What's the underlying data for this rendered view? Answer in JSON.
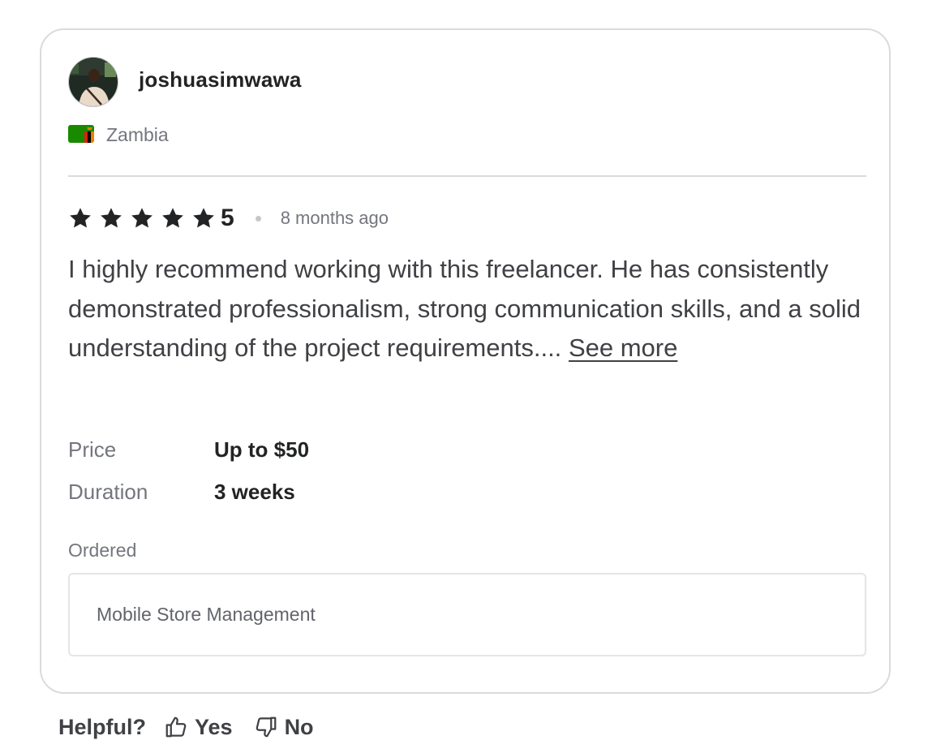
{
  "review": {
    "username": "joshuasimwawa",
    "country": "Zambia",
    "flag_icon": "zambia-flag-icon",
    "rating": {
      "stars": 5,
      "max_stars": 5,
      "score": "5"
    },
    "time_ago": "8 months ago",
    "text": "I highly recommend working with this freelancer. He has consistently demonstrated professionalism, strong communication skills, and a solid understanding of the project requirements....",
    "see_more_label": "See more",
    "details": {
      "price_label": "Price",
      "price_value": "Up to $50",
      "duration_label": "Duration",
      "duration_value": "3 weeks"
    },
    "ordered_label": "Ordered",
    "ordered_item": "Mobile Store Management"
  },
  "helpful": {
    "question": "Helpful?",
    "yes_label": "Yes",
    "no_label": "No",
    "yes_icon": "thumbs-up-icon",
    "no_icon": "thumbs-down-icon"
  },
  "colors": {
    "star": "#222325",
    "text": "#404145",
    "muted": "#74767e",
    "border": "#dadbdd",
    "flag_green": "#198a00",
    "flag_red": "#de2010",
    "flag_orange": "#ef7d00"
  }
}
